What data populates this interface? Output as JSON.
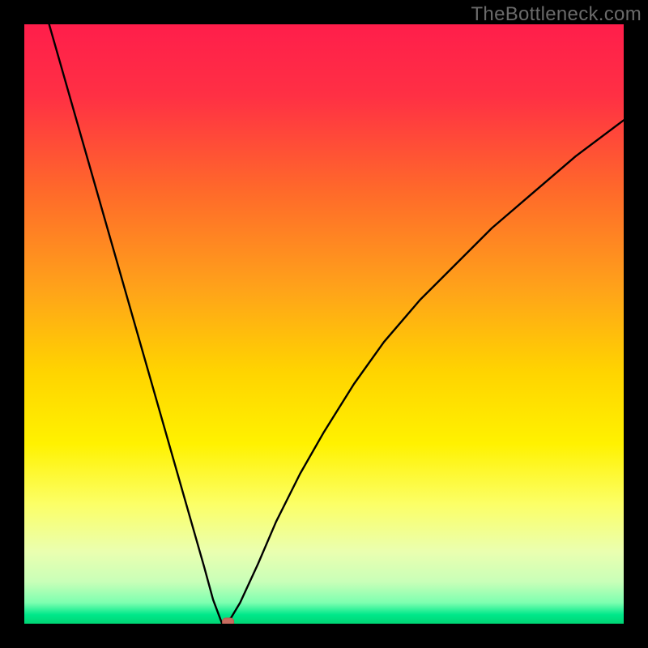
{
  "watermark": "TheBottleneck.com",
  "colors": {
    "frame": "#000000",
    "curve": "#000000",
    "marker_fill": "#c76b5f",
    "marker_stroke": "#b85a4e",
    "gradient_stops": [
      {
        "offset": 0.0,
        "color": "#ff1e4b"
      },
      {
        "offset": 0.12,
        "color": "#ff3044"
      },
      {
        "offset": 0.28,
        "color": "#ff6a2a"
      },
      {
        "offset": 0.44,
        "color": "#ffa21a"
      },
      {
        "offset": 0.58,
        "color": "#ffd400"
      },
      {
        "offset": 0.7,
        "color": "#fff200"
      },
      {
        "offset": 0.8,
        "color": "#fcff66"
      },
      {
        "offset": 0.88,
        "color": "#eaffb0"
      },
      {
        "offset": 0.93,
        "color": "#c9ffb8"
      },
      {
        "offset": 0.965,
        "color": "#7dffb0"
      },
      {
        "offset": 0.985,
        "color": "#00e88a"
      },
      {
        "offset": 1.0,
        "color": "#00d574"
      }
    ]
  },
  "chart_data": {
    "type": "line",
    "title": "",
    "xlabel": "",
    "ylabel": "",
    "xlim": [
      0,
      100
    ],
    "ylim": [
      0,
      100
    ],
    "x_min_at": 33,
    "marker": {
      "x": 34,
      "y": 0
    },
    "series": [
      {
        "name": "bottleneck-curve",
        "x": [
          0,
          3,
          6,
          9,
          12,
          15,
          18,
          21,
          24,
          27,
          30,
          31.5,
          33,
          34.5,
          36,
          39,
          42,
          46,
          50,
          55,
          60,
          66,
          72,
          78,
          85,
          92,
          100
        ],
        "y": [
          115,
          104,
          93.5,
          83,
          72.5,
          62,
          51.5,
          41,
          30.5,
          20,
          9.5,
          4,
          0,
          1,
          3.5,
          10,
          17,
          25,
          32,
          40,
          47,
          54,
          60,
          66,
          72,
          78,
          84
        ]
      }
    ]
  }
}
